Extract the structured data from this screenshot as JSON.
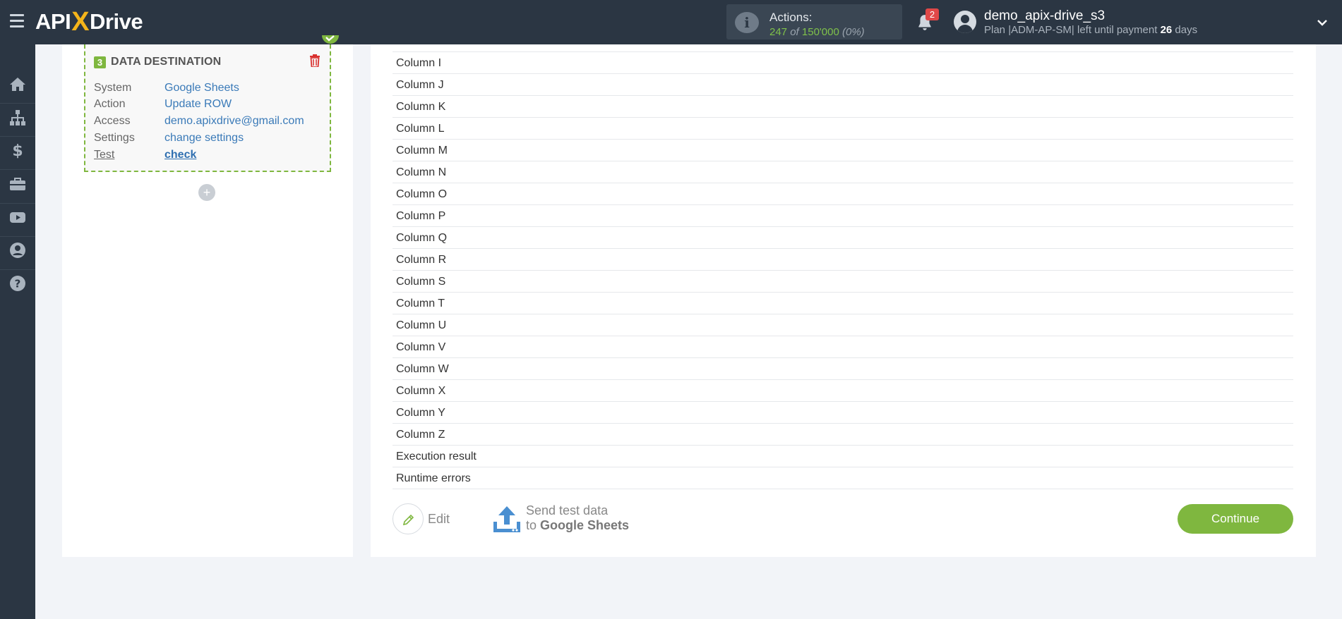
{
  "brand": {
    "logo_left": "API",
    "logo_x": "X",
    "logo_right": "Drive"
  },
  "header": {
    "actions_label": "Actions:",
    "actions_used": "247",
    "actions_of": "of",
    "actions_total": "150'000",
    "actions_percent": "(0%)",
    "notification_count": "2",
    "user_name": "demo_apix-drive_s3",
    "plan_prefix": "Plan |ADM-AP-SM| left until payment",
    "plan_days": "26",
    "plan_suffix": "days"
  },
  "sidebar": {
    "icons": [
      "home-icon",
      "sitemap-icon",
      "dollar-icon",
      "briefcase-icon",
      "youtube-icon",
      "user-circle-icon",
      "help-icon"
    ]
  },
  "destination": {
    "number": "3",
    "title": "DATA DESTINATION",
    "rows": [
      {
        "key": "System",
        "value": "Google Sheets"
      },
      {
        "key": "Action",
        "value": "Update ROW"
      },
      {
        "key": "Access",
        "value": "demo.apixdrive@gmail.com"
      },
      {
        "key": "Settings",
        "value": "change settings"
      },
      {
        "key": "Test",
        "value": "check"
      }
    ],
    "add_symbol": "+"
  },
  "fields": [
    "Column I",
    "Column J",
    "Column K",
    "Column L",
    "Column M",
    "Column N",
    "Column O",
    "Column P",
    "Column Q",
    "Column R",
    "Column S",
    "Column T",
    "Column U",
    "Column V",
    "Column W",
    "Column X",
    "Column Y",
    "Column Z",
    "Execution result",
    "Runtime errors"
  ],
  "footer": {
    "edit_label": "Edit",
    "send_line1": "Send test data",
    "send_to": "to",
    "send_target": "Google Sheets",
    "continue_label": "Continue"
  },
  "colors": {
    "accent_green": "#7fb73f",
    "header_bg": "#2b3643",
    "link_blue": "#3a7ab8"
  }
}
